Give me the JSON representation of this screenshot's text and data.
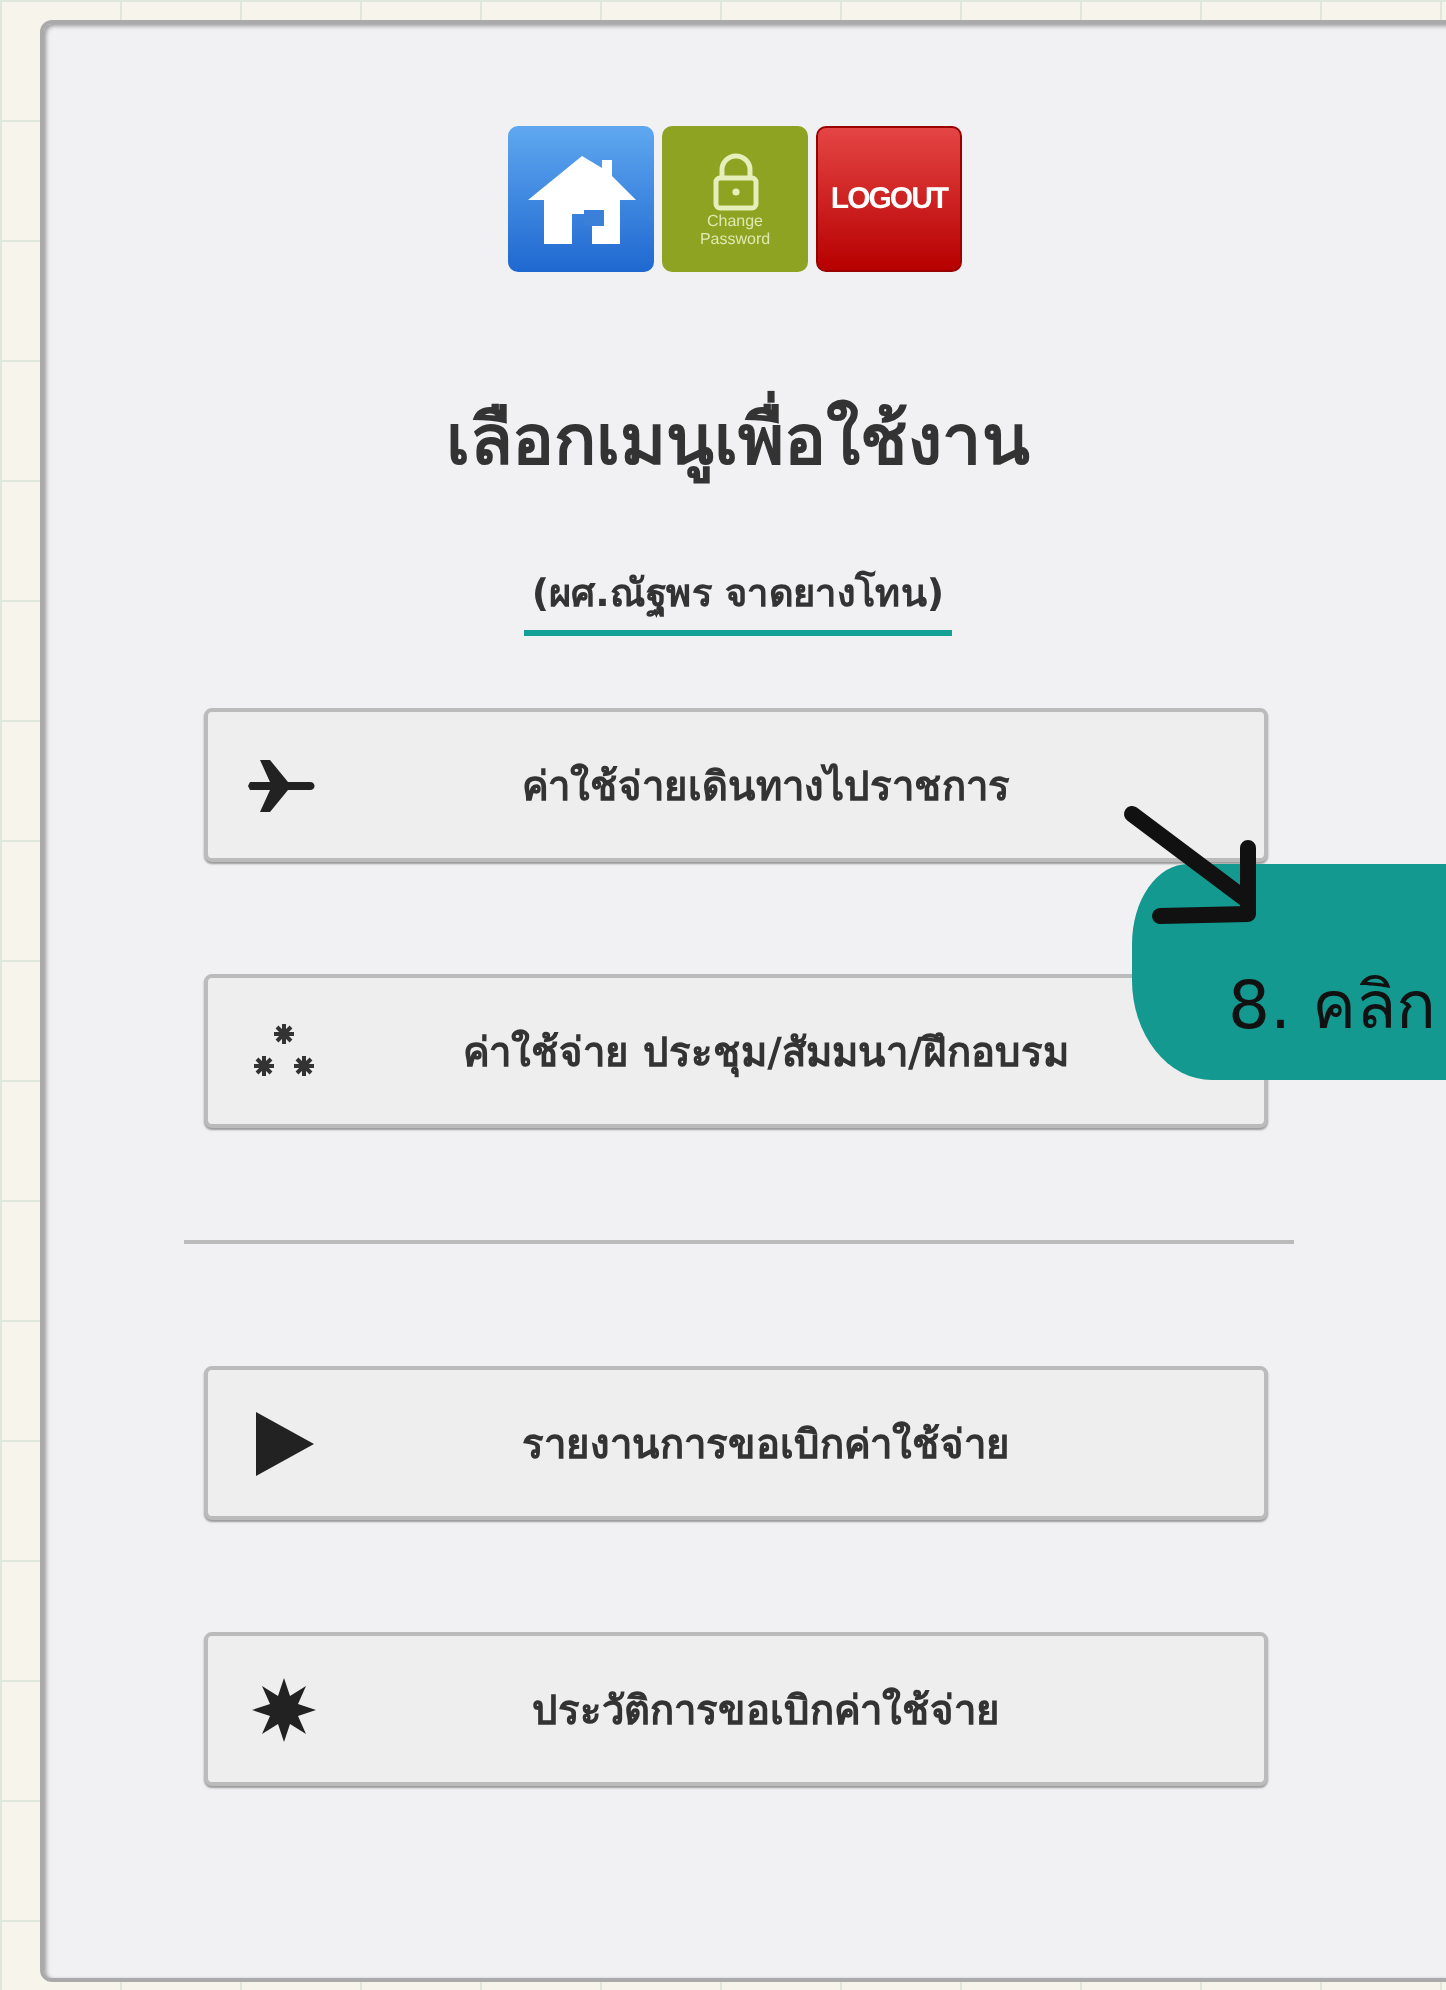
{
  "toolbar": [
    {
      "kind": "home"
    },
    {
      "kind": "password",
      "label_1": "Change",
      "label_2": "Password"
    },
    {
      "kind": "logout",
      "label": "LOGOUT"
    }
  ],
  "title": "เลือกเมนูเพื่อใช้งาน",
  "user_name": "(ผศ.ณัฐพร จาดยางโทน)",
  "menu_groups": [
    [
      {
        "kind": "plane",
        "label": "ค่าใช้จ่ายเดินทางไปราชการ"
      },
      {
        "kind": "sparkle",
        "label": "ค่าใช้จ่าย ประชุม/สัมมนา/ฝึกอบรม"
      }
    ],
    [
      {
        "kind": "play",
        "label": "รายงานการขอเบิกค่าใช้จ่าย"
      },
      {
        "kind": "burst",
        "label": "ประวัติการขอเบิกค่าใช้จ่าย"
      }
    ]
  ],
  "annotation": {
    "text": "8. คลิก"
  }
}
